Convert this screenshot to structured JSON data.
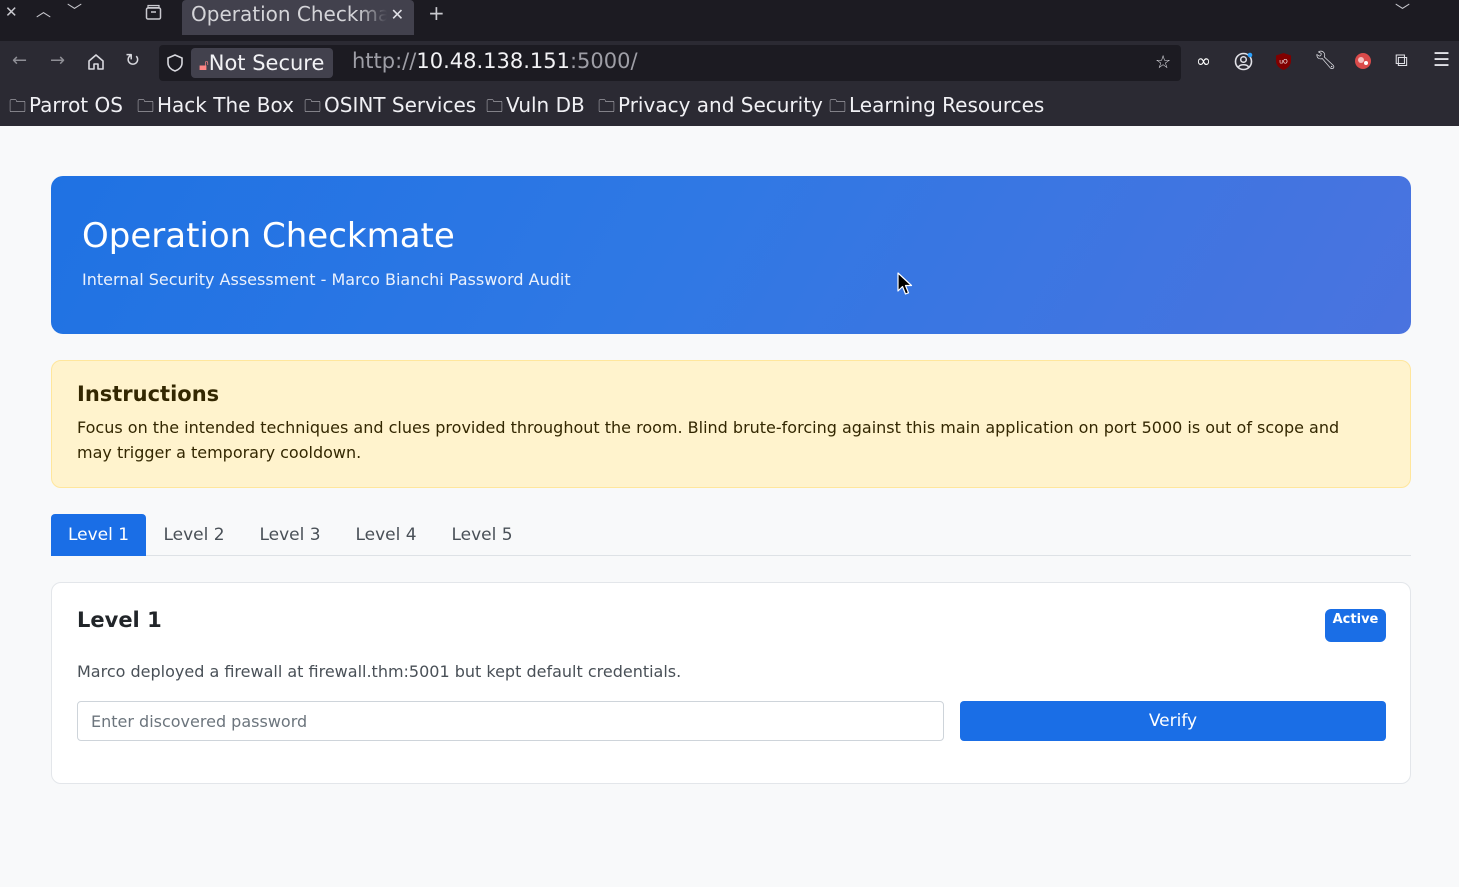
{
  "browser": {
    "tab_title": "Operation Checkmate",
    "security_label": "Not Secure",
    "url_scheme": "http://",
    "url_host": "10.48.138.151",
    "url_rest": ":5000/",
    "bookmarks": [
      "Parrot OS",
      "Hack The Box",
      "OSINT Services",
      "Vuln DB",
      "Privacy and Security",
      "Learning Resources"
    ]
  },
  "hero": {
    "title": "Operation Checkmate",
    "subtitle": "Internal Security Assessment - Marco Bianchi Password Audit"
  },
  "instructions": {
    "title": "Instructions",
    "text": "Focus on the intended techniques and clues provided throughout the room. Blind brute-forcing against this main application on port 5000 is out of scope and may trigger a temporary cooldown."
  },
  "levels": {
    "tabs": [
      "Level 1",
      "Level 2",
      "Level 3",
      "Level 4",
      "Level 5"
    ],
    "active": "Level 1"
  },
  "card": {
    "title": "Level 1",
    "badge": "Active",
    "description": "Marco deployed a firewall at firewall.thm:5001 but kept default credentials.",
    "input_placeholder": "Enter discovered password",
    "input_value": "",
    "button_label": "Verify"
  },
  "colors": {
    "primary": "#1a6ee6",
    "alert_bg": "#fff3cd",
    "chrome_dark": "#1c1b22",
    "chrome": "#2b2a33"
  }
}
